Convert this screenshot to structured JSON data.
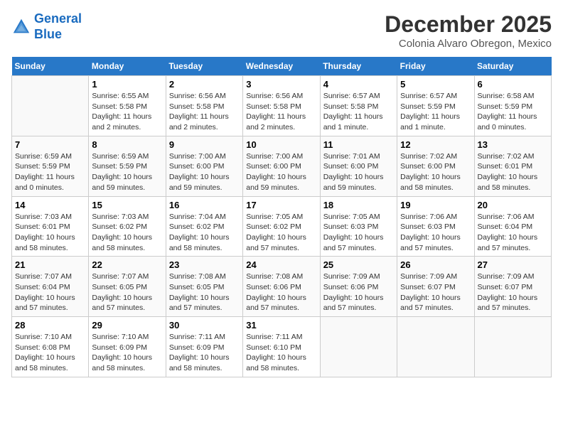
{
  "header": {
    "logo": {
      "line1": "General",
      "line2": "Blue"
    },
    "month": "December 2025",
    "location": "Colonia Alvaro Obregon, Mexico"
  },
  "weekdays": [
    "Sunday",
    "Monday",
    "Tuesday",
    "Wednesday",
    "Thursday",
    "Friday",
    "Saturday"
  ],
  "weeks": [
    [
      {
        "day": "",
        "sunrise": "",
        "sunset": "",
        "daylight": ""
      },
      {
        "day": "1",
        "sunrise": "Sunrise: 6:55 AM",
        "sunset": "Sunset: 5:58 PM",
        "daylight": "Daylight: 11 hours and 2 minutes."
      },
      {
        "day": "2",
        "sunrise": "Sunrise: 6:56 AM",
        "sunset": "Sunset: 5:58 PM",
        "daylight": "Daylight: 11 hours and 2 minutes."
      },
      {
        "day": "3",
        "sunrise": "Sunrise: 6:56 AM",
        "sunset": "Sunset: 5:58 PM",
        "daylight": "Daylight: 11 hours and 2 minutes."
      },
      {
        "day": "4",
        "sunrise": "Sunrise: 6:57 AM",
        "sunset": "Sunset: 5:58 PM",
        "daylight": "Daylight: 11 hours and 1 minute."
      },
      {
        "day": "5",
        "sunrise": "Sunrise: 6:57 AM",
        "sunset": "Sunset: 5:59 PM",
        "daylight": "Daylight: 11 hours and 1 minute."
      },
      {
        "day": "6",
        "sunrise": "Sunrise: 6:58 AM",
        "sunset": "Sunset: 5:59 PM",
        "daylight": "Daylight: 11 hours and 0 minutes."
      }
    ],
    [
      {
        "day": "7",
        "sunrise": "Sunrise: 6:59 AM",
        "sunset": "Sunset: 5:59 PM",
        "daylight": "Daylight: 11 hours and 0 minutes."
      },
      {
        "day": "8",
        "sunrise": "Sunrise: 6:59 AM",
        "sunset": "Sunset: 5:59 PM",
        "daylight": "Daylight: 10 hours and 59 minutes."
      },
      {
        "day": "9",
        "sunrise": "Sunrise: 7:00 AM",
        "sunset": "Sunset: 6:00 PM",
        "daylight": "Daylight: 10 hours and 59 minutes."
      },
      {
        "day": "10",
        "sunrise": "Sunrise: 7:00 AM",
        "sunset": "Sunset: 6:00 PM",
        "daylight": "Daylight: 10 hours and 59 minutes."
      },
      {
        "day": "11",
        "sunrise": "Sunrise: 7:01 AM",
        "sunset": "Sunset: 6:00 PM",
        "daylight": "Daylight: 10 hours and 59 minutes."
      },
      {
        "day": "12",
        "sunrise": "Sunrise: 7:02 AM",
        "sunset": "Sunset: 6:00 PM",
        "daylight": "Daylight: 10 hours and 58 minutes."
      },
      {
        "day": "13",
        "sunrise": "Sunrise: 7:02 AM",
        "sunset": "Sunset: 6:01 PM",
        "daylight": "Daylight: 10 hours and 58 minutes."
      }
    ],
    [
      {
        "day": "14",
        "sunrise": "Sunrise: 7:03 AM",
        "sunset": "Sunset: 6:01 PM",
        "daylight": "Daylight: 10 hours and 58 minutes."
      },
      {
        "day": "15",
        "sunrise": "Sunrise: 7:03 AM",
        "sunset": "Sunset: 6:02 PM",
        "daylight": "Daylight: 10 hours and 58 minutes."
      },
      {
        "day": "16",
        "sunrise": "Sunrise: 7:04 AM",
        "sunset": "Sunset: 6:02 PM",
        "daylight": "Daylight: 10 hours and 58 minutes."
      },
      {
        "day": "17",
        "sunrise": "Sunrise: 7:05 AM",
        "sunset": "Sunset: 6:02 PM",
        "daylight": "Daylight: 10 hours and 57 minutes."
      },
      {
        "day": "18",
        "sunrise": "Sunrise: 7:05 AM",
        "sunset": "Sunset: 6:03 PM",
        "daylight": "Daylight: 10 hours and 57 minutes."
      },
      {
        "day": "19",
        "sunrise": "Sunrise: 7:06 AM",
        "sunset": "Sunset: 6:03 PM",
        "daylight": "Daylight: 10 hours and 57 minutes."
      },
      {
        "day": "20",
        "sunrise": "Sunrise: 7:06 AM",
        "sunset": "Sunset: 6:04 PM",
        "daylight": "Daylight: 10 hours and 57 minutes."
      }
    ],
    [
      {
        "day": "21",
        "sunrise": "Sunrise: 7:07 AM",
        "sunset": "Sunset: 6:04 PM",
        "daylight": "Daylight: 10 hours and 57 minutes."
      },
      {
        "day": "22",
        "sunrise": "Sunrise: 7:07 AM",
        "sunset": "Sunset: 6:05 PM",
        "daylight": "Daylight: 10 hours and 57 minutes."
      },
      {
        "day": "23",
        "sunrise": "Sunrise: 7:08 AM",
        "sunset": "Sunset: 6:05 PM",
        "daylight": "Daylight: 10 hours and 57 minutes."
      },
      {
        "day": "24",
        "sunrise": "Sunrise: 7:08 AM",
        "sunset": "Sunset: 6:06 PM",
        "daylight": "Daylight: 10 hours and 57 minutes."
      },
      {
        "day": "25",
        "sunrise": "Sunrise: 7:09 AM",
        "sunset": "Sunset: 6:06 PM",
        "daylight": "Daylight: 10 hours and 57 minutes."
      },
      {
        "day": "26",
        "sunrise": "Sunrise: 7:09 AM",
        "sunset": "Sunset: 6:07 PM",
        "daylight": "Daylight: 10 hours and 57 minutes."
      },
      {
        "day": "27",
        "sunrise": "Sunrise: 7:09 AM",
        "sunset": "Sunset: 6:07 PM",
        "daylight": "Daylight: 10 hours and 57 minutes."
      }
    ],
    [
      {
        "day": "28",
        "sunrise": "Sunrise: 7:10 AM",
        "sunset": "Sunset: 6:08 PM",
        "daylight": "Daylight: 10 hours and 58 minutes."
      },
      {
        "day": "29",
        "sunrise": "Sunrise: 7:10 AM",
        "sunset": "Sunset: 6:09 PM",
        "daylight": "Daylight: 10 hours and 58 minutes."
      },
      {
        "day": "30",
        "sunrise": "Sunrise: 7:11 AM",
        "sunset": "Sunset: 6:09 PM",
        "daylight": "Daylight: 10 hours and 58 minutes."
      },
      {
        "day": "31",
        "sunrise": "Sunrise: 7:11 AM",
        "sunset": "Sunset: 6:10 PM",
        "daylight": "Daylight: 10 hours and 58 minutes."
      },
      {
        "day": "",
        "sunrise": "",
        "sunset": "",
        "daylight": ""
      },
      {
        "day": "",
        "sunrise": "",
        "sunset": "",
        "daylight": ""
      },
      {
        "day": "",
        "sunrise": "",
        "sunset": "",
        "daylight": ""
      }
    ]
  ]
}
